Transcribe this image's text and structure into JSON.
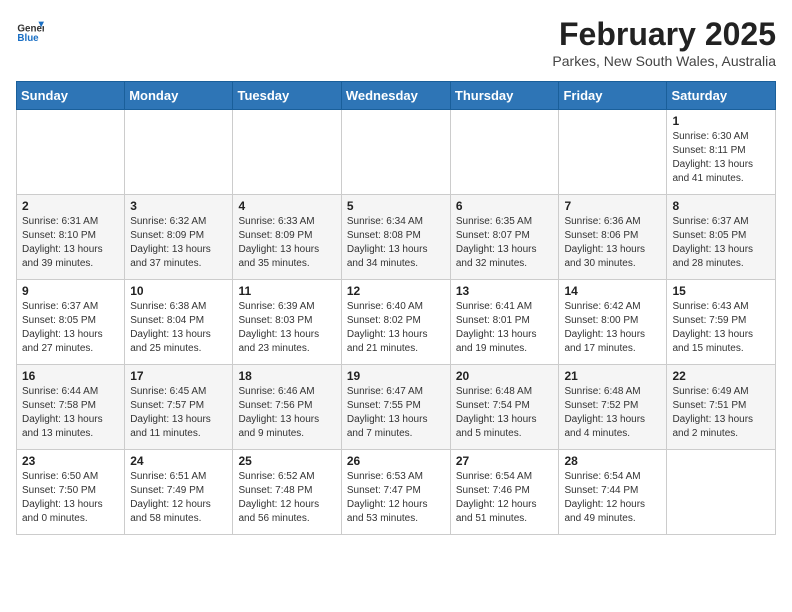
{
  "header": {
    "logo_line1": "General",
    "logo_line2": "Blue",
    "title": "February 2025",
    "subtitle": "Parkes, New South Wales, Australia"
  },
  "weekdays": [
    "Sunday",
    "Monday",
    "Tuesday",
    "Wednesday",
    "Thursday",
    "Friday",
    "Saturday"
  ],
  "weeks": [
    [
      {
        "day": "",
        "info": ""
      },
      {
        "day": "",
        "info": ""
      },
      {
        "day": "",
        "info": ""
      },
      {
        "day": "",
        "info": ""
      },
      {
        "day": "",
        "info": ""
      },
      {
        "day": "",
        "info": ""
      },
      {
        "day": "1",
        "info": "Sunrise: 6:30 AM\nSunset: 8:11 PM\nDaylight: 13 hours\nand 41 minutes."
      }
    ],
    [
      {
        "day": "2",
        "info": "Sunrise: 6:31 AM\nSunset: 8:10 PM\nDaylight: 13 hours\nand 39 minutes."
      },
      {
        "day": "3",
        "info": "Sunrise: 6:32 AM\nSunset: 8:09 PM\nDaylight: 13 hours\nand 37 minutes."
      },
      {
        "day": "4",
        "info": "Sunrise: 6:33 AM\nSunset: 8:09 PM\nDaylight: 13 hours\nand 35 minutes."
      },
      {
        "day": "5",
        "info": "Sunrise: 6:34 AM\nSunset: 8:08 PM\nDaylight: 13 hours\nand 34 minutes."
      },
      {
        "day": "6",
        "info": "Sunrise: 6:35 AM\nSunset: 8:07 PM\nDaylight: 13 hours\nand 32 minutes."
      },
      {
        "day": "7",
        "info": "Sunrise: 6:36 AM\nSunset: 8:06 PM\nDaylight: 13 hours\nand 30 minutes."
      },
      {
        "day": "8",
        "info": "Sunrise: 6:37 AM\nSunset: 8:05 PM\nDaylight: 13 hours\nand 28 minutes."
      }
    ],
    [
      {
        "day": "9",
        "info": "Sunrise: 6:37 AM\nSunset: 8:05 PM\nDaylight: 13 hours\nand 27 minutes."
      },
      {
        "day": "10",
        "info": "Sunrise: 6:38 AM\nSunset: 8:04 PM\nDaylight: 13 hours\nand 25 minutes."
      },
      {
        "day": "11",
        "info": "Sunrise: 6:39 AM\nSunset: 8:03 PM\nDaylight: 13 hours\nand 23 minutes."
      },
      {
        "day": "12",
        "info": "Sunrise: 6:40 AM\nSunset: 8:02 PM\nDaylight: 13 hours\nand 21 minutes."
      },
      {
        "day": "13",
        "info": "Sunrise: 6:41 AM\nSunset: 8:01 PM\nDaylight: 13 hours\nand 19 minutes."
      },
      {
        "day": "14",
        "info": "Sunrise: 6:42 AM\nSunset: 8:00 PM\nDaylight: 13 hours\nand 17 minutes."
      },
      {
        "day": "15",
        "info": "Sunrise: 6:43 AM\nSunset: 7:59 PM\nDaylight: 13 hours\nand 15 minutes."
      }
    ],
    [
      {
        "day": "16",
        "info": "Sunrise: 6:44 AM\nSunset: 7:58 PM\nDaylight: 13 hours\nand 13 minutes."
      },
      {
        "day": "17",
        "info": "Sunrise: 6:45 AM\nSunset: 7:57 PM\nDaylight: 13 hours\nand 11 minutes."
      },
      {
        "day": "18",
        "info": "Sunrise: 6:46 AM\nSunset: 7:56 PM\nDaylight: 13 hours\nand 9 minutes."
      },
      {
        "day": "19",
        "info": "Sunrise: 6:47 AM\nSunset: 7:55 PM\nDaylight: 13 hours\nand 7 minutes."
      },
      {
        "day": "20",
        "info": "Sunrise: 6:48 AM\nSunset: 7:54 PM\nDaylight: 13 hours\nand 5 minutes."
      },
      {
        "day": "21",
        "info": "Sunrise: 6:48 AM\nSunset: 7:52 PM\nDaylight: 13 hours\nand 4 minutes."
      },
      {
        "day": "22",
        "info": "Sunrise: 6:49 AM\nSunset: 7:51 PM\nDaylight: 13 hours\nand 2 minutes."
      }
    ],
    [
      {
        "day": "23",
        "info": "Sunrise: 6:50 AM\nSunset: 7:50 PM\nDaylight: 13 hours\nand 0 minutes."
      },
      {
        "day": "24",
        "info": "Sunrise: 6:51 AM\nSunset: 7:49 PM\nDaylight: 12 hours\nand 58 minutes."
      },
      {
        "day": "25",
        "info": "Sunrise: 6:52 AM\nSunset: 7:48 PM\nDaylight: 12 hours\nand 56 minutes."
      },
      {
        "day": "26",
        "info": "Sunrise: 6:53 AM\nSunset: 7:47 PM\nDaylight: 12 hours\nand 53 minutes."
      },
      {
        "day": "27",
        "info": "Sunrise: 6:54 AM\nSunset: 7:46 PM\nDaylight: 12 hours\nand 51 minutes."
      },
      {
        "day": "28",
        "info": "Sunrise: 6:54 AM\nSunset: 7:44 PM\nDaylight: 12 hours\nand 49 minutes."
      },
      {
        "day": "",
        "info": ""
      }
    ]
  ]
}
